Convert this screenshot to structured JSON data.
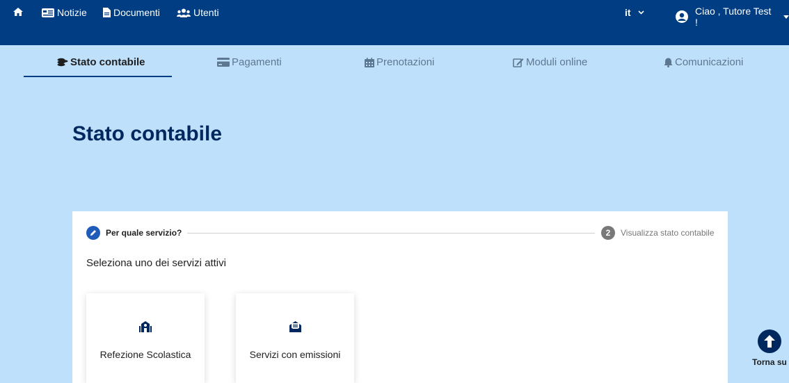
{
  "topbar": {
    "home_icon": "home-icon",
    "items": [
      {
        "label": "Notizie",
        "icon": "newspaper-icon"
      },
      {
        "label": "Documenti",
        "icon": "file-icon"
      },
      {
        "label": "Utenti",
        "icon": "users-icon"
      }
    ],
    "language": "it",
    "user_greeting": "Ciao , Tutore Test !"
  },
  "tabs": [
    {
      "label": "Stato contabile",
      "icon": "coins-icon",
      "active": true
    },
    {
      "label": "Pagamenti",
      "icon": "credit-card-icon",
      "active": false
    },
    {
      "label": "Prenotazioni",
      "icon": "calendar-icon",
      "active": false
    },
    {
      "label": "Moduli online",
      "icon": "edit-icon",
      "active": false
    },
    {
      "label": "Comunicazioni",
      "icon": "bell-icon",
      "active": false
    }
  ],
  "page_title": "Stato contabile",
  "stepper": {
    "step1_label": "Per quale servizio?",
    "step2_number": "2",
    "step2_label": "Visualizza stato contabile"
  },
  "subtitle": "Seleziona uno dei servizi attivi",
  "services": [
    {
      "label": "Refezione Scolastica",
      "icon": "school-icon"
    },
    {
      "label": "Servizi con emissioni",
      "icon": "envelope-open-icon"
    }
  ],
  "back_to_top": "Torna su",
  "colors": {
    "topbar": "#003d82",
    "background": "#bfe0fb",
    "title": "#00285e",
    "step_active": "#1f5bb8"
  }
}
